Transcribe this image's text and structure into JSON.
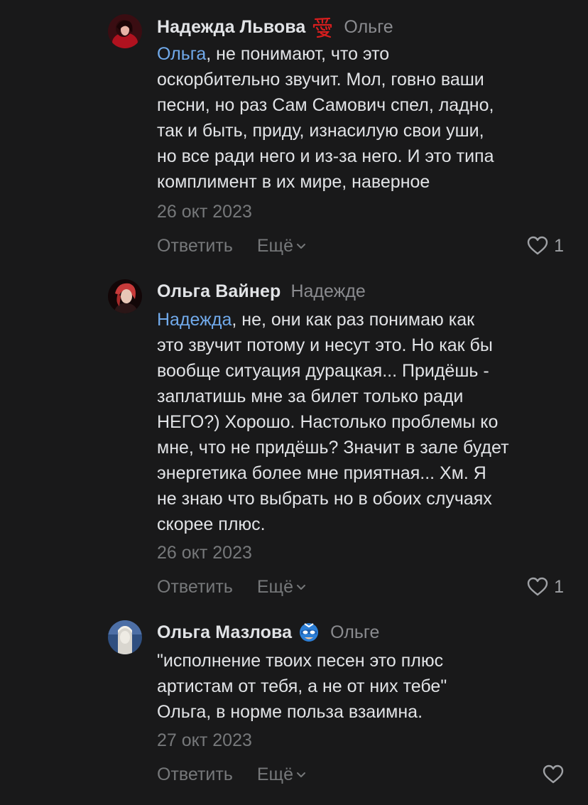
{
  "comments": [
    {
      "author": "Надежда Львова",
      "author_emoji": "heart-kanji-emoji",
      "reply_to": "Ольге",
      "mention": "Ольга",
      "text": ", не понимают, что это\nоскорбительно звучит. Мол, говно ваши\nпесни, но раз Сам Самович спел, ладно,\nтак и быть, приду, изнасилую свои уши,\nно все ради него и из-за него. И это типа\nкомплимент в их мире, наверное",
      "date": "26 окт 2023",
      "reply_label": "Ответить",
      "more_label": "Ещё",
      "likes": "1"
    },
    {
      "author": "Ольга Вайнер",
      "reply_to": "Надежде",
      "mention": "Надежда",
      "text": ", не, они как раз понимаю как\nэто звучит потому и несут это. Но как бы\nвообще ситуация дурацкая... Придёшь -\nзаплатишь мне за билет только ради\nНЕГО?) Хорошо. Настолько проблемы ко\nмне, что не придёшь? Значит в зале будет\nэнергетика более мне приятная... Хм. Я\nне знаю что выбрать но в обоих случаях\nскорее плюс.",
      "date": "26 окт 2023",
      "reply_label": "Ответить",
      "more_label": "Ещё",
      "likes": "1"
    },
    {
      "author": "Ольга Мазлова",
      "author_emoji": "superhero-mask-emoji",
      "reply_to": "Ольге",
      "text": "\"исполнение твоих песен это плюс\nартистам от тебя, а не от них тебе\"\nОльга, в норме польза взаимна.",
      "date": "27 окт 2023",
      "reply_label": "Ответить",
      "more_label": "Ещё",
      "likes": ""
    }
  ],
  "colors": {
    "background": "#19191a",
    "text": "#e1e3e6",
    "secondary": "#76787a",
    "mention": "#71aaeb"
  }
}
